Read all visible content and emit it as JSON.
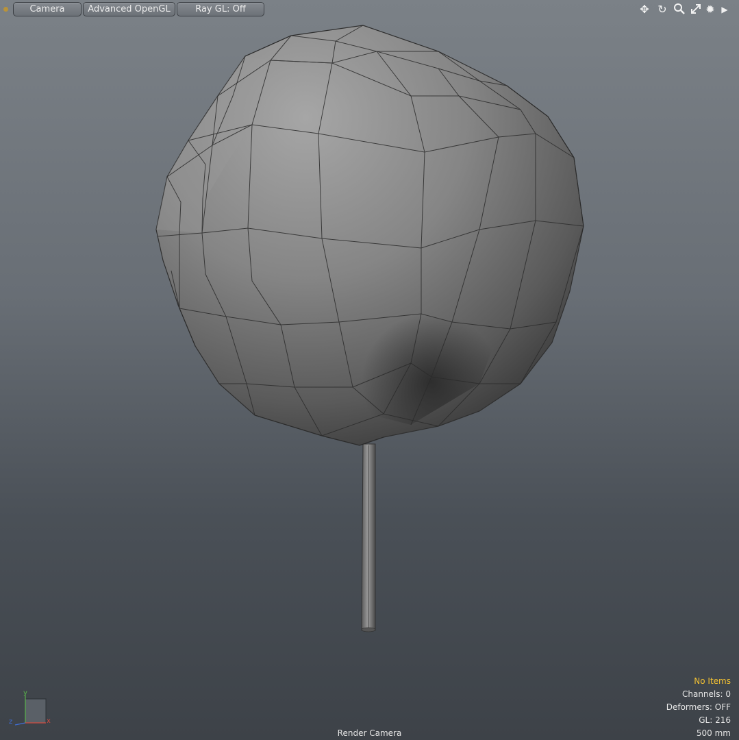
{
  "toolbar": {
    "camera_label": "Camera",
    "shading_label": "Advanced OpenGL",
    "raygl_label": "Ray GL: Off",
    "icons": [
      "move-icon",
      "rotate-icon",
      "zoom-icon",
      "maximize-icon",
      "gear-icon",
      "arrow-right-icon"
    ]
  },
  "viewport": {
    "camera_name": "Render Camera",
    "axes": {
      "y": "y",
      "z": "z",
      "x": "x"
    }
  },
  "info": {
    "items": "No Items",
    "channels": "Channels: 0",
    "deformers": "Deformers: OFF",
    "gl": "GL: 216",
    "scale": "500 mm"
  },
  "colors": {
    "accent_yellow": "#f2c133",
    "axis_x": "#d24a3e",
    "axis_y": "#58b24a",
    "axis_z": "#3f6fd8",
    "mesh": "#8c8c8c"
  }
}
